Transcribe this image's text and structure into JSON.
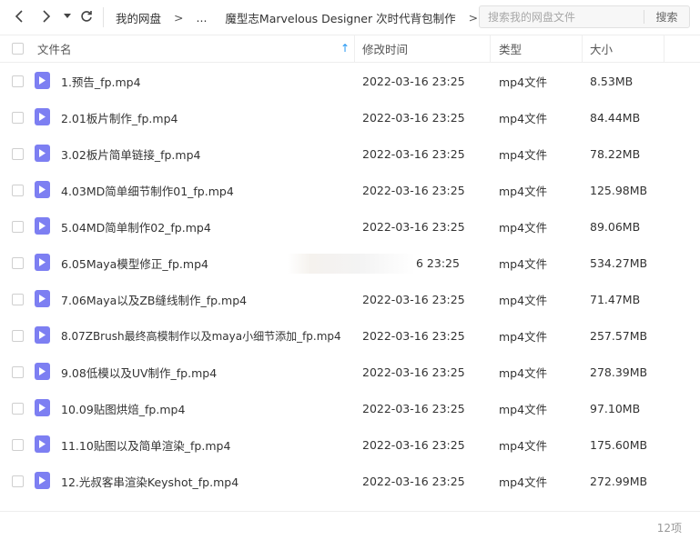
{
  "toolbar": {
    "back_icon": "chevron-left-icon",
    "forward_icon": "chevron-right-icon",
    "dropdown_icon": "caret-down-icon",
    "refresh_icon": "refresh-icon"
  },
  "breadcrumb": {
    "root": "我的网盘",
    "arrow": ">",
    "ellipsis": "...",
    "current": "魔型志Marvelous Designer 次时代背包制作"
  },
  "search": {
    "placeholder": "搜索我的网盘文件",
    "button_label": "搜索"
  },
  "table": {
    "columns": {
      "name": "文件名",
      "modified": "修改时间",
      "type": "类型",
      "size": "大小"
    },
    "sort_indicator": "↑",
    "rows": [
      {
        "name": "1.预告_fp.mp4",
        "modified": "2022-03-16 23:25",
        "type": "mp4文件",
        "size": "8.53MB"
      },
      {
        "name": "2.01板片制作_fp.mp4",
        "modified": "2022-03-16 23:25",
        "type": "mp4文件",
        "size": "84.44MB"
      },
      {
        "name": "3.02板片简单链接_fp.mp4",
        "modified": "2022-03-16 23:25",
        "type": "mp4文件",
        "size": "78.22MB"
      },
      {
        "name": "4.03MD简单细节制作01_fp.mp4",
        "modified": "2022-03-16 23:25",
        "type": "mp4文件",
        "size": "125.98MB"
      },
      {
        "name": "5.04MD简单制作02_fp.mp4",
        "modified": "2022-03-16 23:25",
        "type": "mp4文件",
        "size": "89.06MB"
      },
      {
        "name": "6.05Maya模型修正_fp.mp4",
        "modified": "6 23:25",
        "type": "mp4文件",
        "size": "534.27MB"
      },
      {
        "name": "7.06Maya以及ZB缝线制作_fp.mp4",
        "modified": "2022-03-16 23:25",
        "type": "mp4文件",
        "size": "71.47MB"
      },
      {
        "name": "8.07ZBrush最终高模制作以及maya小细节添加_fp.mp4",
        "modified": "2022-03-16 23:25",
        "type": "mp4文件",
        "size": "257.57MB"
      },
      {
        "name": "9.08低模以及UV制作_fp.mp4",
        "modified": "2022-03-16 23:25",
        "type": "mp4文件",
        "size": "278.39MB"
      },
      {
        "name": "10.09贴图烘焙_fp.mp4",
        "modified": "2022-03-16 23:25",
        "type": "mp4文件",
        "size": "97.10MB"
      },
      {
        "name": "11.10贴图以及简单渲染_fp.mp4",
        "modified": "2022-03-16 23:25",
        "type": "mp4文件",
        "size": "175.60MB"
      },
      {
        "name": "12.光叔客串渲染Keyshot_fp.mp4",
        "modified": "2022-03-16 23:25",
        "type": "mp4文件",
        "size": "272.99MB"
      }
    ]
  },
  "footer": {
    "count": "12项"
  },
  "colors": {
    "file_icon": "#7d7ff2",
    "sort_arrow": "#2196f3"
  }
}
